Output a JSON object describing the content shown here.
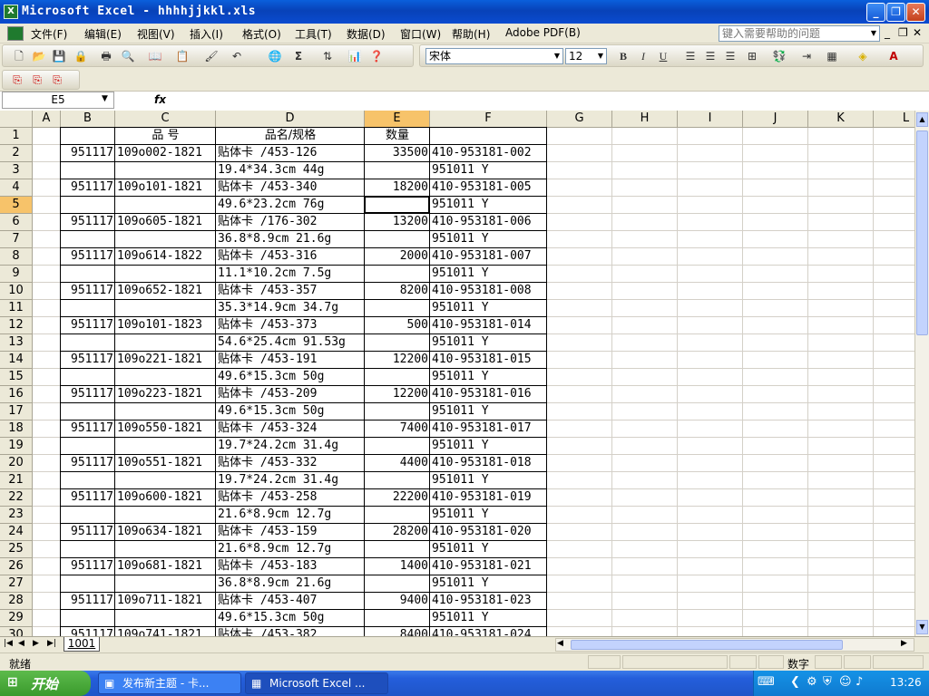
{
  "window": {
    "title": "Microsoft Excel - hhhhjjkkl.xls",
    "app_icon": "X",
    "minimize_glyph": "_",
    "restore_glyph": "❐",
    "close_glyph": "✕"
  },
  "menubar": {
    "items": [
      "文件(F)",
      "编辑(E)",
      "视图(V)",
      "插入(I)",
      "格式(O)",
      "工具(T)",
      "数据(D)",
      "窗口(W)",
      "帮助(H)",
      "Adobe PDF(B)"
    ],
    "help_placeholder": "键入需要帮助的问题",
    "doc_min": "_",
    "doc_restore": "❐",
    "doc_close": "✕"
  },
  "toolbar": {
    "font_name": "宋体",
    "font_size": "12",
    "bold": "B",
    "italic": "I",
    "underline": "U",
    "sum": "Σ"
  },
  "formula_bar": {
    "name_box": "E5",
    "fx": "fx",
    "content": ""
  },
  "columns": [
    "A",
    "B",
    "C",
    "D",
    "E",
    "F",
    "G",
    "H",
    "I",
    "J",
    "K",
    "L"
  ],
  "active_column": "E",
  "active_row": "5",
  "rows": [
    {
      "n": "1",
      "B": "",
      "C": "品    号",
      "D": "品名/规格",
      "E": "数量",
      "F": ""
    },
    {
      "n": "2",
      "B": "951117",
      "C": "109o002-1821",
      "D": "贴体卡 /453-126",
      "E": "33500",
      "F": "410-953181-002"
    },
    {
      "n": "3",
      "B": "",
      "C": "",
      "D": "19.4*34.3cm 44g",
      "E": "",
      "F": "951011 Y"
    },
    {
      "n": "4",
      "B": "951117",
      "C": "109o101-1821",
      "D": "贴体卡 /453-340",
      "E": "18200",
      "F": "410-953181-005"
    },
    {
      "n": "5",
      "B": "",
      "C": "",
      "D": "49.6*23.2cm 76g",
      "E": "",
      "F": "951011 Y"
    },
    {
      "n": "6",
      "B": "951117",
      "C": "109o605-1821",
      "D": "贴体卡 /176-302",
      "E": "13200",
      "F": "410-953181-006"
    },
    {
      "n": "7",
      "B": "",
      "C": "",
      "D": "36.8*8.9cm 21.6g",
      "E": "",
      "F": "951011 Y"
    },
    {
      "n": "8",
      "B": "951117",
      "C": "109o614-1822",
      "D": "贴体卡 /453-316",
      "E": "2000",
      "F": "410-953181-007"
    },
    {
      "n": "9",
      "B": "",
      "C": "",
      "D": "11.1*10.2cm 7.5g",
      "E": "",
      "F": "951011 Y"
    },
    {
      "n": "10",
      "B": "951117",
      "C": "109o652-1821",
      "D": "贴体卡 /453-357",
      "E": "8200",
      "F": "410-953181-008"
    },
    {
      "n": "11",
      "B": "",
      "C": "",
      "D": "35.3*14.9cm 34.7g",
      "E": "",
      "F": "951011 Y"
    },
    {
      "n": "12",
      "B": "951117",
      "C": "109o101-1823",
      "D": "贴体卡 /453-373",
      "E": "500",
      "F": "410-953181-014"
    },
    {
      "n": "13",
      "B": "",
      "C": "",
      "D": "54.6*25.4cm 91.53g",
      "E": "",
      "F": "951011 Y"
    },
    {
      "n": "14",
      "B": "951117",
      "C": "109o221-1821",
      "D": "贴体卡 /453-191",
      "E": "12200",
      "F": "410-953181-015"
    },
    {
      "n": "15",
      "B": "",
      "C": "",
      "D": "49.6*15.3cm 50g",
      "E": "",
      "F": "951011 Y"
    },
    {
      "n": "16",
      "B": "951117",
      "C": "109o223-1821",
      "D": "贴体卡 /453-209",
      "E": "12200",
      "F": "410-953181-016"
    },
    {
      "n": "17",
      "B": "",
      "C": "",
      "D": "49.6*15.3cm 50g",
      "E": "",
      "F": "951011 Y"
    },
    {
      "n": "18",
      "B": "951117",
      "C": "109o550-1821",
      "D": "贴体卡 /453-324",
      "E": "7400",
      "F": "410-953181-017"
    },
    {
      "n": "19",
      "B": "",
      "C": "",
      "D": "19.7*24.2cm 31.4g",
      "E": "",
      "F": "951011 Y"
    },
    {
      "n": "20",
      "B": "951117",
      "C": "109o551-1821",
      "D": "贴体卡 /453-332",
      "E": "4400",
      "F": "410-953181-018"
    },
    {
      "n": "21",
      "B": "",
      "C": "",
      "D": "19.7*24.2cm 31.4g",
      "E": "",
      "F": "951011 Y"
    },
    {
      "n": "22",
      "B": "951117",
      "C": "109o600-1821",
      "D": "贴体卡 /453-258",
      "E": "22200",
      "F": "410-953181-019"
    },
    {
      "n": "23",
      "B": "",
      "C": "",
      "D": "21.6*8.9cm 12.7g",
      "E": "",
      "F": "951011 Y"
    },
    {
      "n": "24",
      "B": "951117",
      "C": "109o634-1821",
      "D": "贴体卡 /453-159",
      "E": "28200",
      "F": "410-953181-020"
    },
    {
      "n": "25",
      "B": "",
      "C": "",
      "D": "21.6*8.9cm 12.7g",
      "E": "",
      "F": "951011 Y"
    },
    {
      "n": "26",
      "B": "951117",
      "C": "109o681-1821",
      "D": "贴体卡 /453-183",
      "E": "1400",
      "F": "410-953181-021"
    },
    {
      "n": "27",
      "B": "",
      "C": "",
      "D": "36.8*8.9cm 21.6g",
      "E": "",
      "F": "951011 Y"
    },
    {
      "n": "28",
      "B": "951117",
      "C": "109o711-1821",
      "D": "贴体卡 /453-407",
      "E": "9400",
      "F": "410-953181-023"
    },
    {
      "n": "29",
      "B": "",
      "C": "",
      "D": "49.6*15.3cm 50g",
      "E": "",
      "F": "951011 Y"
    },
    {
      "n": "30",
      "B": "951117",
      "C": "109o741-1821",
      "D": "贴体卡 /453-382",
      "E": "8400",
      "F": "410-953181-024"
    }
  ],
  "sheet_tabs": {
    "active": "1001",
    "nav": [
      "|◀",
      "◀",
      "▶",
      "▶|"
    ]
  },
  "status": {
    "left": "就绪",
    "mode": "数字"
  },
  "taskbar": {
    "start": "开始",
    "tasks": [
      "发布新主题 - 卡...",
      "Microsoft Excel ..."
    ],
    "clock": "13:26"
  }
}
